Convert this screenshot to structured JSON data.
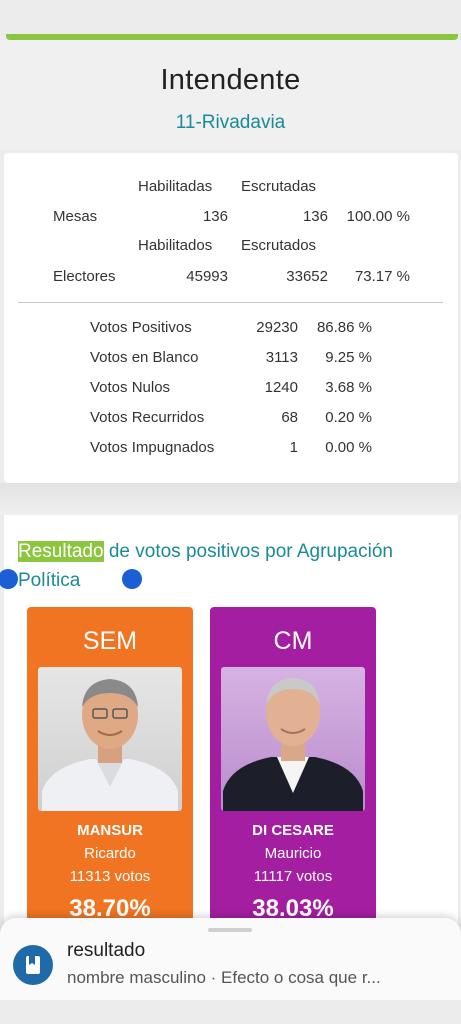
{
  "page": {
    "title": "Intendente",
    "subtitle": "11-Rivadavia"
  },
  "stats": {
    "mesas_headers": [
      "Habilitadas",
      "Escrutadas"
    ],
    "mesas": {
      "label": "Mesas",
      "habilitadas": "136",
      "escrutadas": "136",
      "pct": "100.00 %"
    },
    "electores_headers": [
      "Habilitados",
      "Escrutados"
    ],
    "electores": {
      "label": "Electores",
      "habilitados": "45993",
      "escrutados": "33652",
      "pct": "73.17 %"
    },
    "votos": [
      {
        "label": "Votos Positivos",
        "count": "29230",
        "pct": "86.86 %"
      },
      {
        "label": "Votos en Blanco",
        "count": "3113",
        "pct": "9.25 %"
      },
      {
        "label": "Votos Nulos",
        "count": "1240",
        "pct": "3.68 %"
      },
      {
        "label": "Votos Recurridos",
        "count": "68",
        "pct": "0.20 %"
      },
      {
        "label": "Votos Impugnados",
        "count": "1",
        "pct": "0.00 %"
      }
    ]
  },
  "result": {
    "heading_highlight": "Resultado",
    "heading_rest": " de votos positivos por Agrupación Política"
  },
  "candidates": [
    {
      "party": "SEM",
      "last_name": "MANSUR",
      "first_name": "Ricardo",
      "votes": "11313 votos",
      "pct": "38.70%",
      "color": "#f07422"
    },
    {
      "party": "CM",
      "last_name": "DI CESARE",
      "first_name": "Mauricio",
      "votes": "11117 votos",
      "pct": "38.03%",
      "color": "#a31ea0"
    }
  ],
  "lookup_sheet": {
    "icon": "book-icon",
    "word": "resultado",
    "definition": "nombre masculino · Efecto o cosa que r..."
  },
  "colors": {
    "accent": "#8cc63f",
    "teal": "#1a8a9a",
    "selection": "#1a5fd4"
  }
}
